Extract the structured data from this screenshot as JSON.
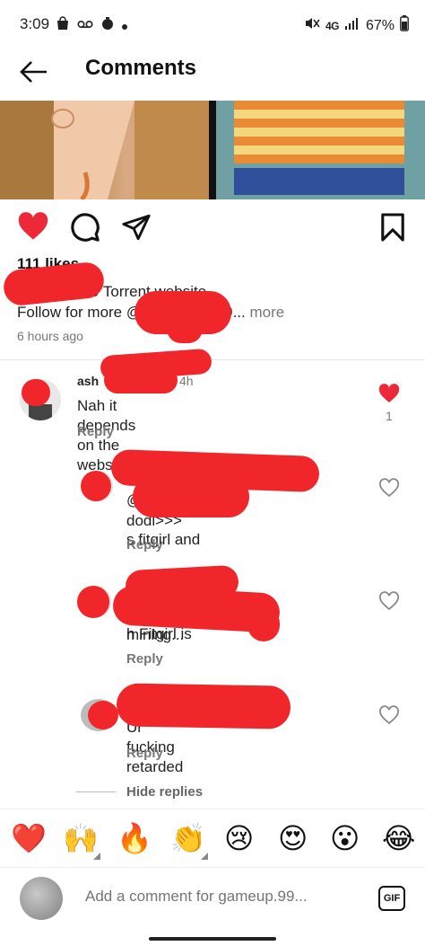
{
  "status": {
    "time": "3:09",
    "network": "4G",
    "battery": "67%"
  },
  "header": {
    "title": "Comments"
  },
  "post": {
    "likes": "111 likes",
    "caption_line1": "9 Torrent website",
    "caption_line2_prefix": "Follow for more @",
    "caption_line2_suffix": "9...",
    "more": "more",
    "time_ago": "6 hours ago"
  },
  "comments": [
    {
      "username": "ash",
      "time": "4h",
      "text": "Nah it depends on the website",
      "reply": "Reply",
      "like_count": "1",
      "liked": true
    },
    {
      "username": "",
      "time": "",
      "text_line1": "@",
      "text_line1_suffix": "s fitgirl and",
      "text_line2": "dodi>>>",
      "reply": "Reply",
      "liked": false
    },
    {
      "username": "",
      "time": "h",
      "text_line1_suffix": "h Fitgirl is",
      "text_line2": "mining...",
      "reply": "Reply",
      "liked": false
    },
    {
      "username": "",
      "time": "",
      "text_line1": "Ur fucking retarded",
      "reply": "Reply",
      "liked": false
    }
  ],
  "hide_replies": "Hide replies",
  "emoji_bar": [
    {
      "glyph": "❤️",
      "name": "red-heart"
    },
    {
      "glyph": "🙌",
      "name": "raising-hands"
    },
    {
      "glyph": "🔥",
      "name": "fire"
    },
    {
      "glyph": "👏",
      "name": "clapping-hands"
    },
    {
      "glyph": "😢",
      "name": "crying-face"
    },
    {
      "glyph": "😍",
      "name": "heart-eyes"
    },
    {
      "glyph": "😮",
      "name": "surprised-face"
    },
    {
      "glyph": "😂",
      "name": "tears-of-joy"
    }
  ],
  "composer": {
    "placeholder": "Add a comment for gameup.99...",
    "gif_label": "GIF"
  },
  "colors": {
    "heart_red": "#ed2839",
    "redaction_red": "#f0262a",
    "muted_text": "#777777"
  }
}
